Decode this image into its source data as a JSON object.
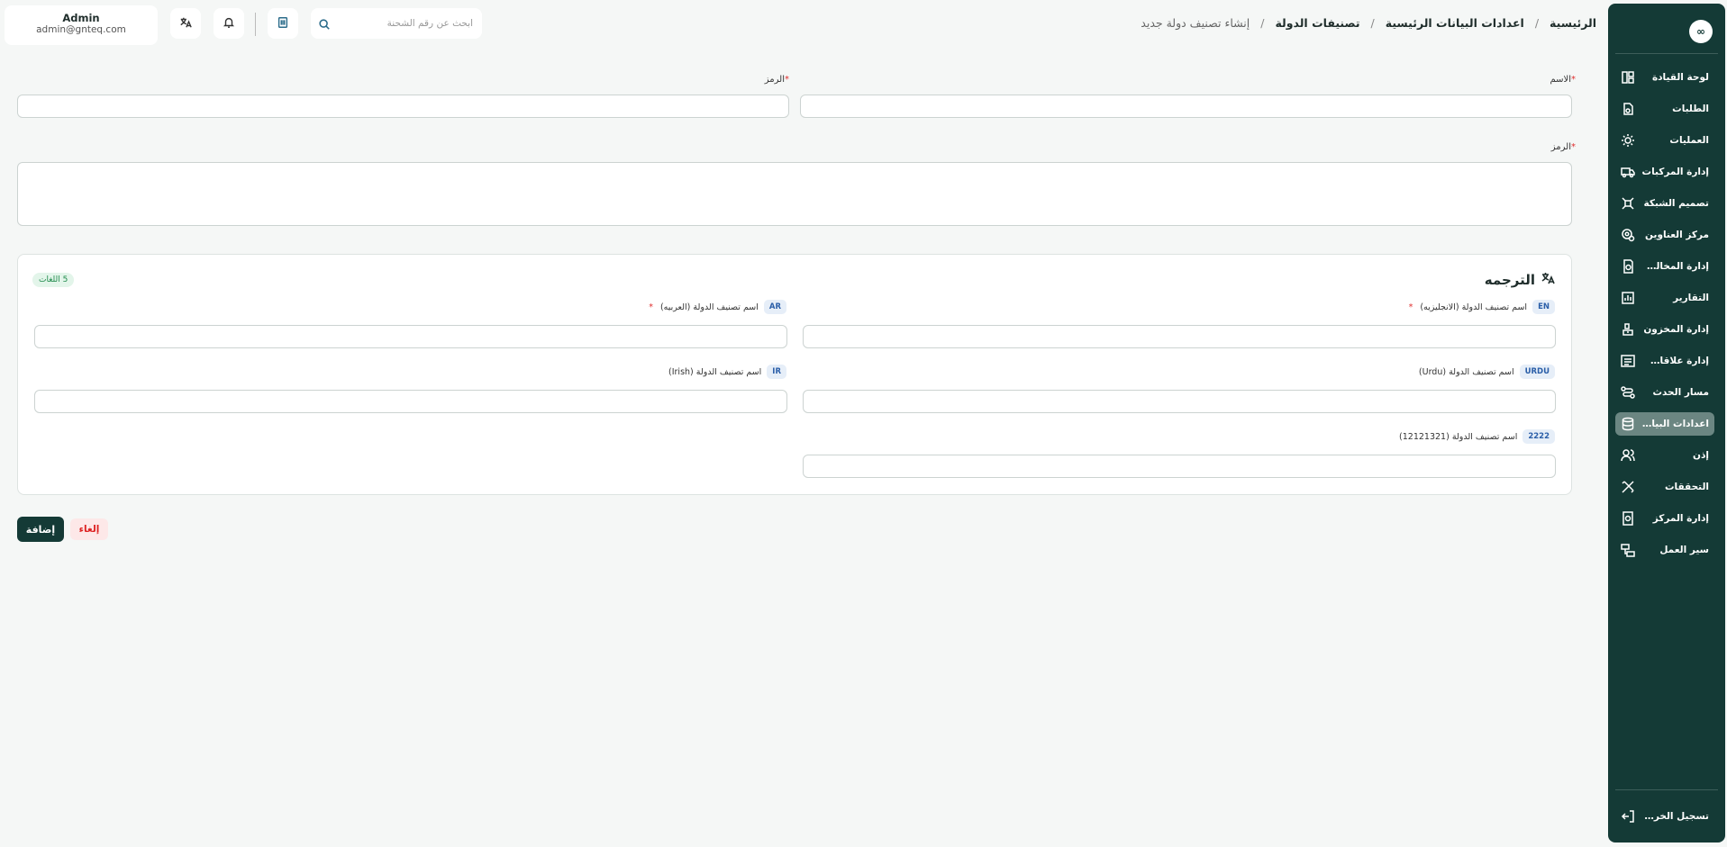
{
  "header": {
    "user": {
      "name": "Admin",
      "email": "admin@gnteq.com"
    },
    "search_placeholder": "ابحث عن رقم الشحنة",
    "breadcrumb": [
      "الرئيسية",
      "اعدادات البيانات الرئيسية",
      "تصنيفات الدولة",
      "إنشاء تصنيف دولة جديد"
    ]
  },
  "sidebar": {
    "items": [
      {
        "label": "لوحة القيادة",
        "icon": "dashboard-icon"
      },
      {
        "label": "الطلبات",
        "icon": "orders-icon"
      },
      {
        "label": "العمليات",
        "icon": "operations-icon"
      },
      {
        "label": "إدارة المركبات",
        "icon": "truck-icon"
      },
      {
        "label": "تصميم الشبكة",
        "icon": "network-icon"
      },
      {
        "label": "مركز العناوين",
        "icon": "location-icon"
      },
      {
        "label": "إدارة المخالفات",
        "icon": "violations-icon"
      },
      {
        "label": "التقارير",
        "icon": "reports-icon"
      },
      {
        "label": "إدارة المخزون",
        "icon": "inventory-icon"
      },
      {
        "label": "إدارة علاقات العملاء",
        "icon": "crm-icon"
      },
      {
        "label": "مسار الحدث",
        "icon": "route-icon"
      },
      {
        "label": "اعدادات البيانات...",
        "icon": "database-icon",
        "active": true
      },
      {
        "label": "إذن",
        "icon": "users-icon"
      },
      {
        "label": "التحققات",
        "icon": "tools-icon"
      },
      {
        "label": "إدارة المركز",
        "icon": "center-icon"
      },
      {
        "label": "سير العمل",
        "icon": "workflow-icon"
      }
    ],
    "logout": "تسجيل الخروج"
  },
  "form": {
    "name_label": "الاسم",
    "code_label": "الرمز",
    "description_label": "الرمز",
    "translation": {
      "title": "الترجمه",
      "count_badge": "5 اللغات",
      "fields": [
        {
          "code": "EN",
          "label": "اسم تصنيف الدولة (الانجليزيه)",
          "required": true
        },
        {
          "code": "AR",
          "label": "اسم تصنيف الدولة (العربيه)",
          "required": true
        },
        {
          "code": "URDU",
          "label": "اسم تصنيف الدولة (Urdu)",
          "required": false
        },
        {
          "code": "IR",
          "label": "اسم تصنيف الدولة (Irish)",
          "required": false
        },
        {
          "code": "2222",
          "label": "اسم تصنيف الدولة (12121321)",
          "required": false
        }
      ]
    },
    "add_button": "إضافة",
    "cancel_button": "إلغاء"
  }
}
